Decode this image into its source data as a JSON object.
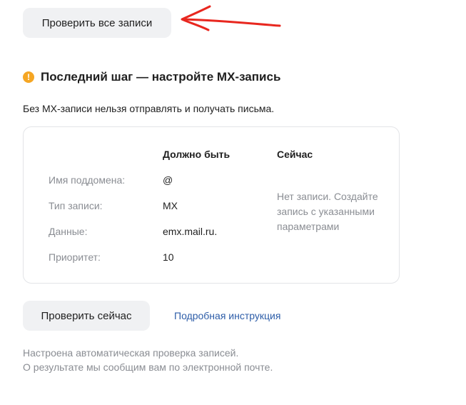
{
  "buttons": {
    "check_all": "Проверить все записи",
    "check_now": "Проверить сейчас"
  },
  "annotation": {
    "icon": "red-arrow-left-icon",
    "color": "#e8271f"
  },
  "step": {
    "icon": "warning-icon",
    "icon_glyph": "!",
    "icon_color": "#f5a623",
    "title": "Последний шаг — настройте MX-запись",
    "description": "Без MX-записи нельзя отправлять и получать письма."
  },
  "table": {
    "headers": {
      "expected": "Должно быть",
      "current": "Сейчас"
    },
    "rows": [
      {
        "label": "Имя поддомена:",
        "expected": "@"
      },
      {
        "label": "Тип записи:",
        "expected": "MX"
      },
      {
        "label": "Данные:",
        "expected": "emx.mail.ru."
      },
      {
        "label": "Приоритет:",
        "expected": "10"
      }
    ],
    "current_status": "Нет записи. Создайте запись с указанными параметрами"
  },
  "links": {
    "instructions": "Подробная инструкция"
  },
  "footer": {
    "line1": "Настроена автоматическая проверка записей.",
    "line2": "О результате мы сообщим вам по электронной почте."
  }
}
